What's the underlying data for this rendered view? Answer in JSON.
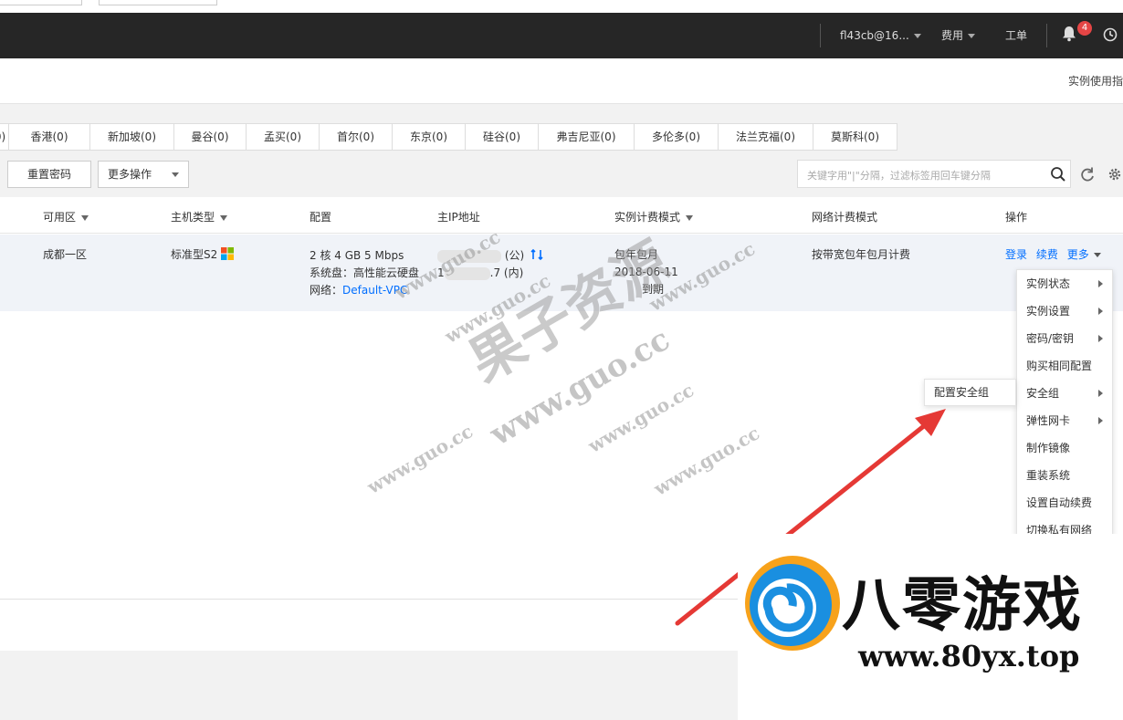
{
  "header": {
    "account": "fl43cb@16...",
    "billing": "费用",
    "ticket": "工单",
    "notification_count": "4"
  },
  "subheader": {
    "guide_link": "实例使用指"
  },
  "regions": [
    {
      "label": "0)"
    },
    {
      "label": "香港(0)"
    },
    {
      "label": "新加坡(0)"
    },
    {
      "label": "曼谷(0)"
    },
    {
      "label": "孟买(0)"
    },
    {
      "label": "首尔(0)"
    },
    {
      "label": "东京(0)"
    },
    {
      "label": "硅谷(0)"
    },
    {
      "label": "弗吉尼亚(0)"
    },
    {
      "label": "多伦多(0)"
    },
    {
      "label": "法兰克福(0)"
    },
    {
      "label": "莫斯科(0)"
    }
  ],
  "toolbar": {
    "reset_password": "重置密码",
    "more_actions": "更多操作",
    "search_placeholder": "关键字用\"|\"分隔，过滤标签用回车键分隔"
  },
  "table": {
    "columns": {
      "zone": "可用区",
      "host_type": "主机类型",
      "config": "配置",
      "ip": "主IP地址",
      "billing_mode": "实例计费模式",
      "net_billing": "网络计费模式",
      "ops": "操作"
    },
    "row": {
      "zone": "成都一区",
      "host_type": "标准型S2",
      "config_line1": "2 核 4 GB 5 Mbps",
      "config_line2": "系统盘：高性能云硬盘",
      "config_line3_prefix": "网络：",
      "config_line3_link": "Default-VPC",
      "ip_public_suffix": "(公)",
      "ip_private_prefix": "1",
      "ip_private_suffix": ".7 (内)",
      "billing_mode": "包年包月",
      "billing_date": "2018-06-11",
      "billing_expire": "到期",
      "net_billing": "按带宽包年包月计费",
      "op_login": "登录",
      "op_renew": "续费",
      "op_more": "更多"
    }
  },
  "menu": {
    "items": [
      {
        "label": "实例状态",
        "sub": true
      },
      {
        "label": "实例设置",
        "sub": true
      },
      {
        "label": "密码/密钥",
        "sub": true
      },
      {
        "label": "购买相同配置",
        "sub": false
      },
      {
        "label": "安全组",
        "sub": true
      },
      {
        "label": "弹性网卡",
        "sub": true
      },
      {
        "label": "制作镜像",
        "sub": false
      },
      {
        "label": "重装系统",
        "sub": false
      },
      {
        "label": "设置自动续费",
        "sub": false
      },
      {
        "label": "切换私有网络",
        "sub": false
      }
    ],
    "submenu_item": "配置安全组"
  },
  "watermark": {
    "domain": "www.guo.cc",
    "brand": "果子资源"
  },
  "logo": {
    "name": "八零游戏",
    "url": "www.80yx.top"
  },
  "colors": {
    "header_bg": "#262626",
    "link": "#006eff",
    "badge": "#e54545",
    "arrow": "#e53935"
  }
}
